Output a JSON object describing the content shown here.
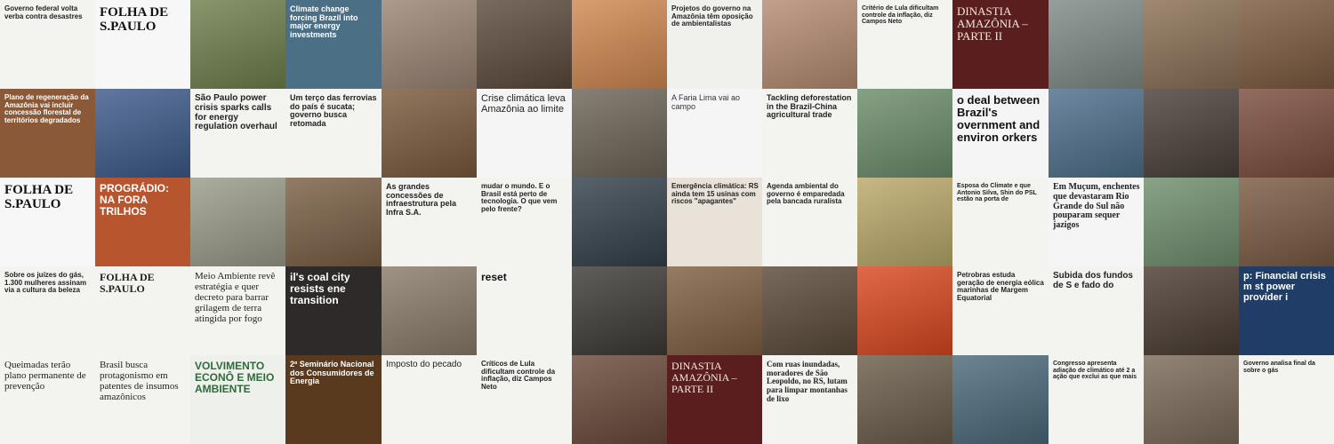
{
  "tiles": [
    {
      "id": "r1c1",
      "bg": "#f3f3f0",
      "fg": "#222222",
      "text": "Governo federal volta verba contra desastres",
      "size": 8,
      "weight": "700"
    },
    {
      "id": "r1c2",
      "bg": "#f7f7f7",
      "fg": "#111111",
      "text": "FOLHA DE S.PAULO",
      "size": 15,
      "weight": "700",
      "font": "serif"
    },
    {
      "id": "r1c3",
      "bg": "#6f7f4c",
      "fg": "#ffffff",
      "text": "",
      "size": 8
    },
    {
      "id": "r1c4",
      "bg": "#4b6f84",
      "fg": "#ffffff",
      "text": "Climate change forcing Brazil into major energy investments",
      "size": 9,
      "weight": "700"
    },
    {
      "id": "r1c5",
      "bg": "#9a8574",
      "fg": "#ffffff",
      "text": "",
      "size": 8
    },
    {
      "id": "r1c6",
      "bg": "#5b4a3c",
      "fg": "#ffffff",
      "text": "",
      "size": 8
    },
    {
      "id": "r1c7",
      "bg": "#d08850",
      "fg": "#ffffff",
      "text": "",
      "size": 8
    },
    {
      "id": "r1c8",
      "bg": "#f0f0ec",
      "fg": "#222222",
      "text": "Projetos do governo na Amazônia têm oposição de ambientalistas",
      "size": 8,
      "weight": "700"
    },
    {
      "id": "r1c9",
      "bg": "#b58b72",
      "fg": "#ffffff",
      "text": "",
      "size": 8
    },
    {
      "id": "r1c10",
      "bg": "#f3f3f0",
      "fg": "#222222",
      "text": "Critério de Lula dificultam controle da inflação, diz Campos Neto",
      "size": 7,
      "weight": "700"
    },
    {
      "id": "r1c11",
      "bg": "#5a1e1e",
      "fg": "#f2e8e0",
      "text": "DINASTIA AMAZÔNIA – PARTE II",
      "size": 13,
      "weight": "400",
      "font": "serif"
    },
    {
      "id": "r1c12",
      "bg": "#7f8a85",
      "fg": "#ffffff",
      "text": "",
      "size": 8
    },
    {
      "id": "r1c13",
      "bg": "#8a6f55",
      "fg": "#ffffff",
      "text": "",
      "size": 8
    },
    {
      "id": "r1c14",
      "bg": "#7c5a3f",
      "fg": "#ffffff",
      "text": "",
      "size": 8
    },
    {
      "id": "r2c1",
      "bg": "#8a5a38",
      "fg": "#ffffff",
      "text": "Plano de regeneração da Amazônia vai incluir concessão florestal de territórios degradados",
      "size": 8,
      "weight": "700"
    },
    {
      "id": "r2c2",
      "bg": "#3d5a8a",
      "fg": "#ffffff",
      "text": "",
      "size": 8
    },
    {
      "id": "r2c3",
      "bg": "#f3f3f0",
      "fg": "#222222",
      "text": "São Paulo power crisis sparks calls for energy regulation overhaul",
      "size": 10,
      "weight": "700"
    },
    {
      "id": "r2c4",
      "bg": "#f3f3f0",
      "fg": "#222222",
      "text": "Um terço das ferrovias do país é sucata; governo busca retomada",
      "size": 9,
      "weight": "700"
    },
    {
      "id": "r2c5",
      "bg": "#7a5a3c",
      "fg": "#ffffff",
      "text": "",
      "size": 8
    },
    {
      "id": "r2c6",
      "bg": "#f5f5f5",
      "fg": "#222222",
      "text": "Crise climática leva Amazônia ao limite",
      "size": 11,
      "weight": "400"
    },
    {
      "id": "r2c7",
      "bg": "#6d6457",
      "fg": "#ffffff",
      "text": "",
      "size": 8
    },
    {
      "id": "r2c8",
      "bg": "#f5f5f5",
      "fg": "#333333",
      "text": "A Faria Lima vai ao campo",
      "size": 9,
      "weight": "400"
    },
    {
      "id": "r2c9",
      "bg": "#f3f3f0",
      "fg": "#222222",
      "text": "Tackling deforestation in the Brazil-China agricultural trade",
      "size": 9,
      "weight": "700"
    },
    {
      "id": "r2c10",
      "bg": "#6b8d6a",
      "fg": "#ffffff",
      "text": "",
      "size": 8
    },
    {
      "id": "r2c11",
      "bg": "#f5f5f5",
      "fg": "#111111",
      "text": "o deal between Brazil's overnment and environ orkers",
      "size": 13,
      "weight": "700"
    },
    {
      "id": "r2c12",
      "bg": "#4d6e8a",
      "fg": "#ffffff",
      "text": "",
      "size": 8
    },
    {
      "id": "r2c13",
      "bg": "#4a3f39",
      "fg": "#ffffff",
      "text": "",
      "size": 8
    },
    {
      "id": "r2c14",
      "bg": "#7a4c3c",
      "fg": "#ffffff",
      "text": "",
      "size": 8
    },
    {
      "id": "r3c1",
      "bg": "#f7f7f7",
      "fg": "#111111",
      "text": "FOLHA DE S.PAULO",
      "size": 15,
      "weight": "700",
      "font": "serif"
    },
    {
      "id": "r3c2",
      "bg": "#b7552e",
      "fg": "#ffffff",
      "text": "PROGRÁDIO: NA FORA TRILHOS",
      "size": 12,
      "weight": "700"
    },
    {
      "id": "r3c3",
      "bg": "#9a9a8a",
      "fg": "#ffffff",
      "text": "",
      "size": 8
    },
    {
      "id": "r3c4",
      "bg": "#7a5f45",
      "fg": "#ffffff",
      "text": "",
      "size": 8
    },
    {
      "id": "r3c5",
      "bg": "#f3f3f0",
      "fg": "#222222",
      "text": "As grandes concessões de infraestrutura pela Infra S.A.",
      "size": 9,
      "weight": "700"
    },
    {
      "id": "r3c6",
      "bg": "#f3f3f0",
      "fg": "#222222",
      "text": "mudar o mundo. E o Brasil está perto de tecnologia. O que vem pelo frente?",
      "size": 8,
      "weight": "700"
    },
    {
      "id": "r3c7",
      "bg": "#33404a",
      "fg": "#ffffff",
      "text": "",
      "size": 8
    },
    {
      "id": "r3c8",
      "bg": "#e9e2d8",
      "fg": "#222222",
      "text": "Emergência climática: RS ainda tem 15 usinas com riscos \"apagantes\"",
      "size": 8,
      "weight": "700"
    },
    {
      "id": "r3c9",
      "bg": "#f3f3f0",
      "fg": "#222222",
      "text": "Agenda ambiental do governo é emparedada pela bancada ruralista",
      "size": 8,
      "weight": "700"
    },
    {
      "id": "r3c10",
      "bg": "#b9a96a",
      "fg": "#ffffff",
      "text": "",
      "size": 8
    },
    {
      "id": "r3c11",
      "bg": "#f3f3f0",
      "fg": "#222222",
      "text": "Esposa do Climate e que Antonio Silva, Shin do PSL estão na porta de",
      "size": 7,
      "weight": "700"
    },
    {
      "id": "r3c12",
      "bg": "#f5f5f5",
      "fg": "#222222",
      "text": "Em Muçum, enchentes que devastaram Rio Grande do Sul não pouparam sequer jazigos",
      "size": 10,
      "weight": "700",
      "font": "serif"
    },
    {
      "id": "r3c13",
      "bg": "#6f8f6f",
      "fg": "#ffffff",
      "text": "",
      "size": 8
    },
    {
      "id": "r3c14",
      "bg": "#7a5a42",
      "fg": "#ffffff",
      "text": "",
      "size": 8
    },
    {
      "id": "r4c1",
      "bg": "#f3f3f0",
      "fg": "#222222",
      "text": "Sobre os juízes do gás, 1.300 mulheres assinam via a cultura da beleza",
      "size": 8,
      "weight": "700"
    },
    {
      "id": "r4c2",
      "bg": "#f3f3f0",
      "fg": "#222222",
      "text": "FOLHA DE S.PAULO",
      "size": 12,
      "weight": "700",
      "font": "serif"
    },
    {
      "id": "r4c3",
      "bg": "#f3f3f0",
      "fg": "#222222",
      "text": "Meio Ambiente revê estratégia e quer decreto para barrar grilagem de terra atingida por fogo",
      "size": 11,
      "weight": "400",
      "font": "serif"
    },
    {
      "id": "r4c4",
      "bg": "#2e2a2a",
      "fg": "#ffffff",
      "text": "il's coal city resists ene transition",
      "size": 12,
      "weight": "700"
    },
    {
      "id": "r4c5",
      "bg": "#8a7b6a",
      "fg": "#ffffff",
      "text": "",
      "size": 8
    },
    {
      "id": "r4c6",
      "bg": "#f3f3f0",
      "fg": "#111111",
      "text": "reset",
      "size": 12,
      "weight": "700"
    },
    {
      "id": "r4c7",
      "bg": "#3d3a36",
      "fg": "#ffffff",
      "text": "",
      "size": 8
    },
    {
      "id": "r4c8",
      "bg": "#7f5f42",
      "fg": "#ffffff",
      "text": "",
      "size": 8
    },
    {
      "id": "r4c9",
      "bg": "#5a4a3a",
      "fg": "#ffffff",
      "text": "",
      "size": 8
    },
    {
      "id": "r4c10",
      "bg": "#d94820",
      "fg": "#ffffff",
      "text": "",
      "size": 8
    },
    {
      "id": "r4c11",
      "bg": "#f3f3f0",
      "fg": "#222222",
      "text": "Petrobras estuda geração de energia eólica marinhas de Margem Equatorial",
      "size": 8,
      "weight": "700"
    },
    {
      "id": "r4c12",
      "bg": "#f3f3f0",
      "fg": "#222222",
      "text": "Subida dos fundos de S e fado do",
      "size": 10,
      "weight": "700"
    },
    {
      "id": "r4c13",
      "bg": "#4a3c32",
      "fg": "#ffffff",
      "text": "",
      "size": 8
    },
    {
      "id": "r4c14",
      "bg": "#1f3d66",
      "fg": "#ffffff",
      "text": "p: Financial crisis m st power provider i",
      "size": 11,
      "weight": "700"
    },
    {
      "id": "r5c1",
      "bg": "#f3f3f0",
      "fg": "#222222",
      "text": "Queimadas terão plano permanente de prevenção",
      "size": 11,
      "weight": "400",
      "font": "serif"
    },
    {
      "id": "r5c2",
      "bg": "#f3f3f0",
      "fg": "#222222",
      "text": "Brasil busca protagonismo em patentes de insumos amazônicos",
      "size": 11,
      "weight": "400",
      "font": "serif"
    },
    {
      "id": "r5c3",
      "bg": "#eef0ec",
      "fg": "#2f6b3a",
      "text": "VOLVIMENTO ECONÔ E MEIO AMBIENTE",
      "size": 12,
      "weight": "700"
    },
    {
      "id": "r5c4",
      "bg": "#5a3a1e",
      "fg": "#ffffff",
      "text": "2º Seminário Nacional dos Consumidores de Energia",
      "size": 9,
      "weight": "700"
    },
    {
      "id": "r5c5",
      "bg": "#f3f3f0",
      "fg": "#222222",
      "text": "Imposto do pecado",
      "size": 10,
      "weight": "400"
    },
    {
      "id": "r5c6",
      "bg": "#f3f3f0",
      "fg": "#222222",
      "text": "Críticos de Lula dificultam controle da inflação, diz Campos Neto",
      "size": 8,
      "weight": "700"
    },
    {
      "id": "r5c7",
      "bg": "#6a4a3a",
      "fg": "#ffffff",
      "text": "",
      "size": 8
    },
    {
      "id": "r5c8",
      "bg": "#5a1e1e",
      "fg": "#f2e8e0",
      "text": "DINASTIA AMAZÔNIA – PARTE II",
      "size": 12,
      "weight": "400",
      "font": "serif"
    },
    {
      "id": "r5c9",
      "bg": "#f3f3f0",
      "fg": "#222222",
      "text": "Com ruas inundadas, moradores de São Leopoldo, no RS, lutam para limpar montanhas de lixo",
      "size": 9,
      "weight": "700",
      "font": "serif"
    },
    {
      "id": "r5c10",
      "bg": "#6b5c4a",
      "fg": "#ffffff",
      "text": "",
      "size": 8
    },
    {
      "id": "r5c11",
      "bg": "#4a6a7a",
      "fg": "#ffffff",
      "text": "",
      "size": 8
    },
    {
      "id": "r5c12",
      "bg": "#f3f3f0",
      "fg": "#222222",
      "text": "Congresso apresenta adiação de climático até 2 a ação que exclui as que mais",
      "size": 7,
      "weight": "700"
    },
    {
      "id": "r5c13",
      "bg": "#7a6a5a",
      "fg": "#ffffff",
      "text": "",
      "size": 8
    },
    {
      "id": "r5c14",
      "bg": "#f3f3f0",
      "fg": "#222222",
      "text": "Governo analisa final da sobre o gás",
      "size": 7,
      "weight": "700"
    }
  ]
}
